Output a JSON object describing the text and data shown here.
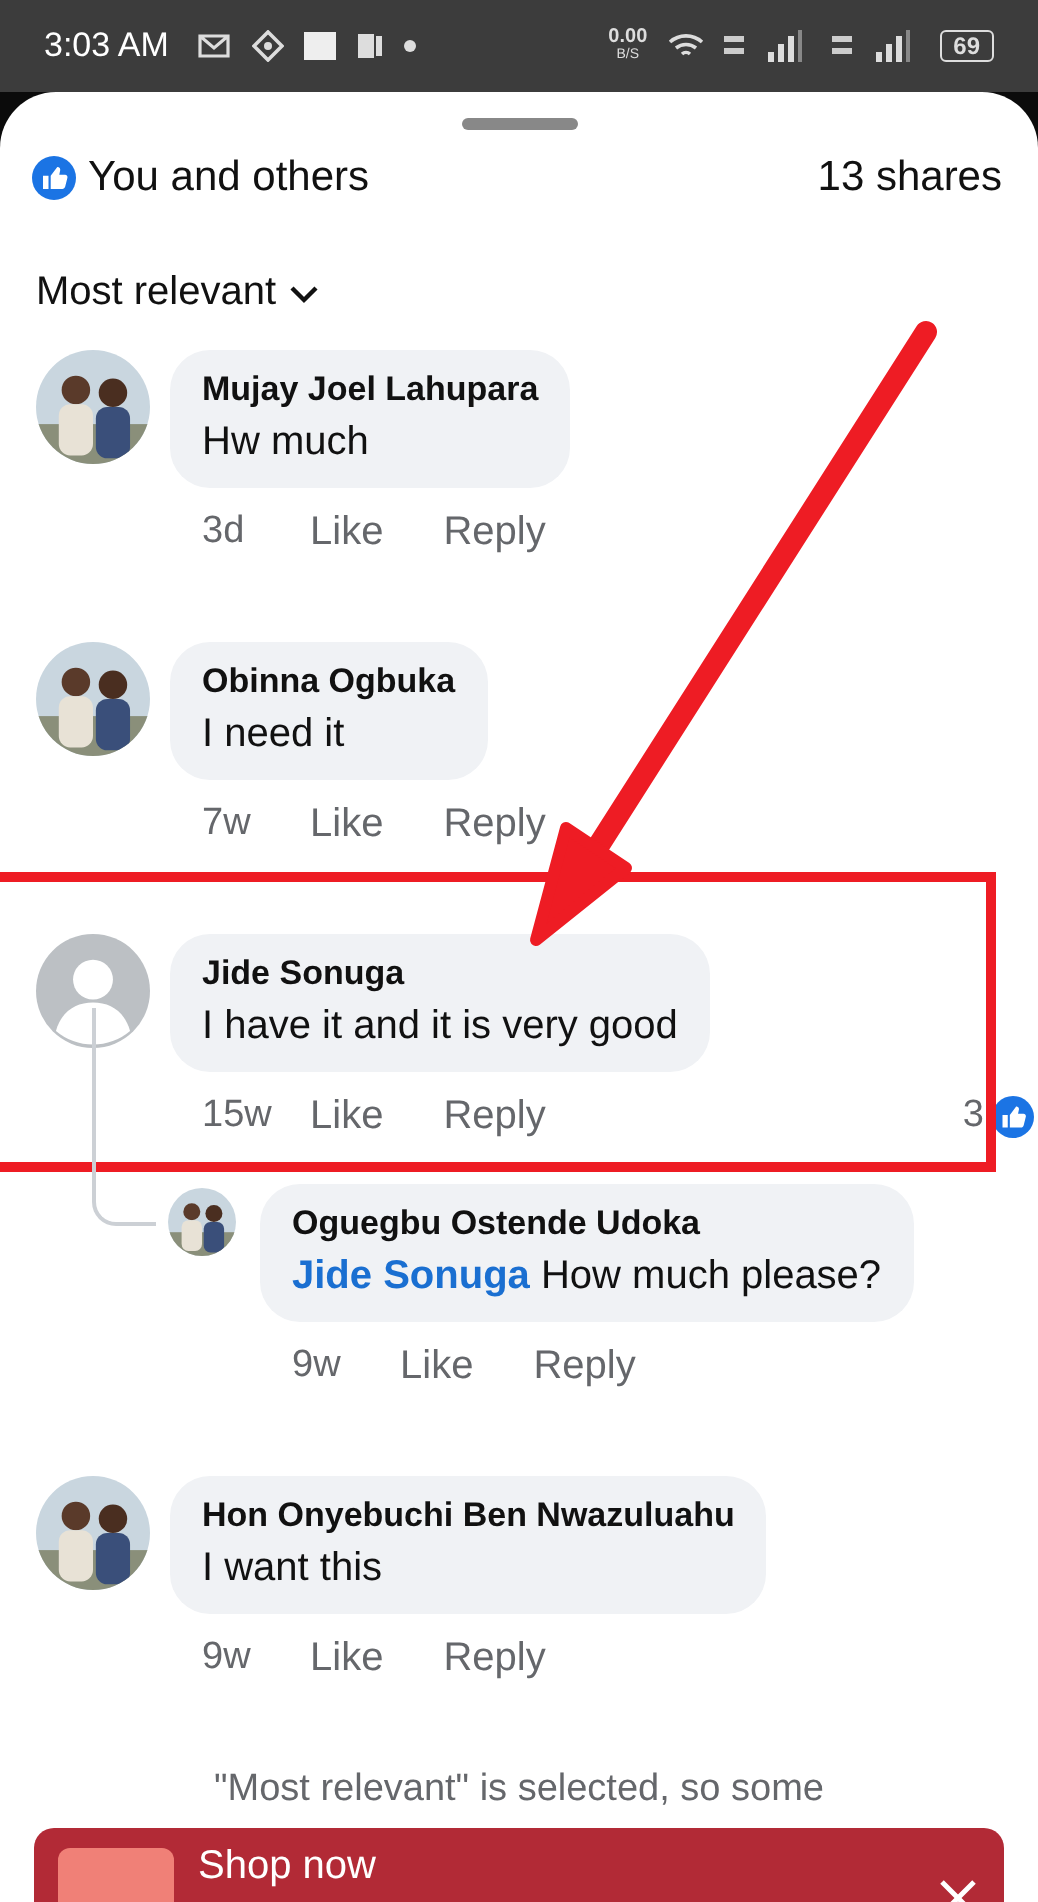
{
  "status_bar": {
    "time": "3:03 AM",
    "net_speed": "0.00",
    "net_unit": "B/S",
    "battery": "69"
  },
  "header": {
    "reactions": "You and others",
    "shares": "13 shares"
  },
  "sort": {
    "label": "Most relevant"
  },
  "comments": [
    {
      "author": "Mujay Joel Lahupara",
      "text": "Hw much",
      "time": "3d",
      "like": "Like",
      "reply": "Reply",
      "highlighted": false
    },
    {
      "author": "Obinna Ogbuka",
      "text": "I need it",
      "time": "7w",
      "like": "Like",
      "reply": "Reply",
      "highlighted": false
    },
    {
      "author": "Jide Sonuga",
      "text": "I have it and it is very good",
      "time": "15w",
      "like": "Like",
      "reply": "Reply",
      "avatar": {
        "kind": "default"
      },
      "highlighted": true,
      "reaction_count": "3",
      "children": [
        {
          "author": "Oguegbu Ostende Udoka",
          "mention": "Jide Sonuga",
          "text": "How much please?",
          "time": "9w",
          "like": "Like",
          "reply": "Reply",
          "highlighted": false
        }
      ]
    },
    {
      "author": "Hon Onyebuchi Ben Nwazuluahu",
      "text": "I want this",
      "time": "9w",
      "like": "Like",
      "reply": "Reply",
      "highlighted": false
    }
  ],
  "notice": "\"Most relevant\" is selected, so some",
  "banner": {
    "title": "Shop now"
  }
}
